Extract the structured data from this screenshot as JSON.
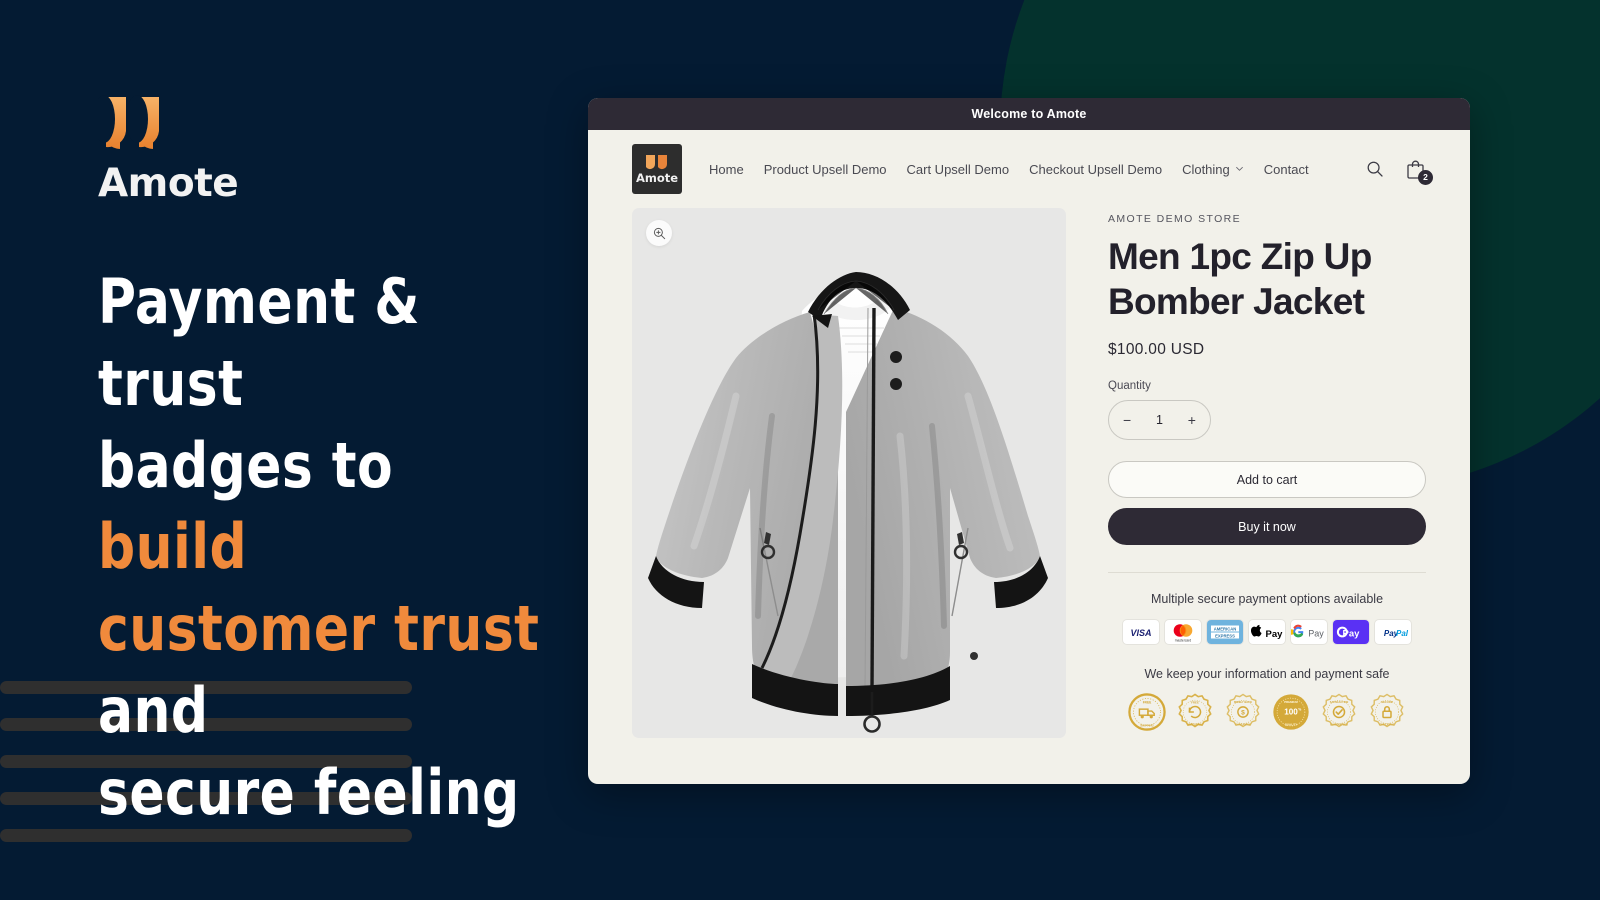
{
  "brand": {
    "name": "Amote",
    "logo_icon": "quote-marks-icon",
    "accent_color": "#F08A3C",
    "background_color": "#041B33",
    "circle_color": "#04322D"
  },
  "hero": {
    "headline_parts": [
      {
        "text": "Payment & trust badges to ",
        "accent": false
      },
      {
        "text": "build customer trust",
        "accent": true
      },
      {
        "text": " and secure feeling",
        "accent": false
      }
    ],
    "headline_plain": "Payment & trust badges to build customer trust and secure feeling",
    "line1": "Payment & trust",
    "line2a": "badges to ",
    "line2b": "build",
    "line3a": "customer trust",
    "line3b": " and",
    "line4": "secure feeling"
  },
  "browser": {
    "announcement": "Welcome to Amote",
    "nav": {
      "logo_label": "Amote",
      "links": [
        {
          "label": "Home",
          "has_caret": false
        },
        {
          "label": "Product Upsell Demo",
          "has_caret": false
        },
        {
          "label": "Cart Upsell Demo",
          "has_caret": false
        },
        {
          "label": "Checkout Upsell Demo",
          "has_caret": false
        },
        {
          "label": "Clothing",
          "has_caret": true
        },
        {
          "label": "Contact",
          "has_caret": false
        }
      ],
      "search_icon": "search-icon",
      "cart_icon": "shopping-bag-icon",
      "cart_count": "2"
    },
    "gallery": {
      "zoom_icon": "zoom-in-icon",
      "product_image_alt": "Men 1pc Zip Up Bomber Jacket"
    },
    "product": {
      "vendor": "AMOTE DEMO STORE",
      "title": "Men 1pc Zip Up Bomber Jacket",
      "price": "$100.00 USD",
      "quantity_label": "Quantity",
      "quantity_decrease": "−",
      "quantity_value": "1",
      "quantity_increase": "+",
      "add_to_cart_label": "Add to cart",
      "buy_now_label": "Buy it now"
    },
    "payments": {
      "heading": "Multiple secure payment options available",
      "methods": [
        {
          "name": "visa",
          "label": "VISA"
        },
        {
          "name": "mastercard",
          "label": "mastercard"
        },
        {
          "name": "american-express",
          "label": "AMERICAN EXPRESS"
        },
        {
          "name": "apple-pay",
          "label": "Pay"
        },
        {
          "name": "google-pay",
          "label": "Pay"
        },
        {
          "name": "shop-pay",
          "label": "Pay"
        },
        {
          "name": "paypal",
          "label": "PayPal"
        }
      ]
    },
    "trust": {
      "heading": "We keep your information and payment safe",
      "badge_color": "#D4A939",
      "badges": [
        {
          "name": "free-shipping-badge",
          "label": "FREE SHIPPING"
        },
        {
          "name": "free-returns-badge",
          "label": "FREE RETURNS"
        },
        {
          "name": "money-back-badge",
          "label": "MONEY BACK GUARANTEE"
        },
        {
          "name": "premium-quality-badge",
          "label": "PREMIUM 100% QUALITY"
        },
        {
          "name": "satisfaction-guarantee-badge",
          "label": "SATISFACTION GUARANTEED"
        },
        {
          "name": "secure-checkout-badge",
          "label": "SECURE CHECKOUT"
        }
      ]
    }
  },
  "decor": {
    "stripe_count": 5,
    "stripe_color": "#2f2f2f"
  }
}
